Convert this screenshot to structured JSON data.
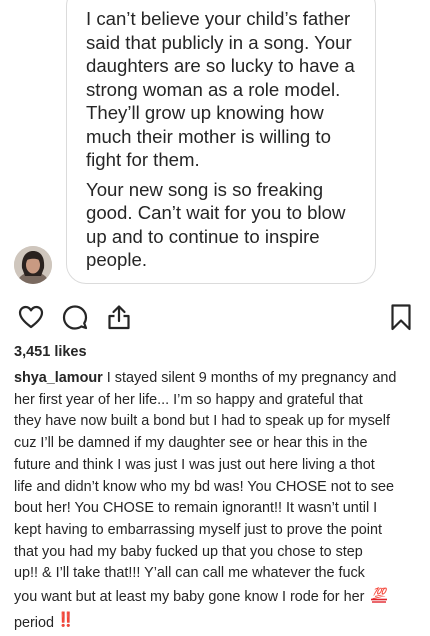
{
  "message": {
    "paragraph_1": "I can’t believe your child’s father\nsaid that publicly in a song. Your\ndaughters are so lucky to have a\nstrong woman as a role model.\nThey’ll grow up knowing how\nmuch their mother is willing to\nfight for them.",
    "paragraph_2": "Your new song is so freaking\ngood. Can’t wait for you to blow\nup and to continue to inspire\npeople."
  },
  "actions": {
    "icons": [
      "heart-icon",
      "comment-icon",
      "share-icon",
      "bookmark-icon"
    ]
  },
  "post": {
    "likes": "3,451 likes",
    "username": "shya_lamour",
    "caption_lines": [
      "I stayed silent 9 months of my pregnancy and",
      "her first year of her life... I’m so happy and grateful that",
      "they have now built a bond but I had to speak up for myself",
      "cuz I’ll be damned if my daughter see or hear this in the",
      "future and think I was just I was just out here living a thot",
      "life and didn’t know who my bd was! You CHOSE not to see",
      "bout her! You CHOSE to remain ignorant!! It wasn’t until I",
      "kept having to embarrassing myself just to prove the point",
      "that you had my baby fucked up that you chose to step",
      "up!! & I’ll take that!!! Y’all can call me whatever the fuck",
      "you want but at least my baby gone know I rode for her",
      "period"
    ],
    "emoji_hundred": "💯",
    "emoji_double_exclamation": "‼️"
  },
  "colors": {
    "text": "#262626",
    "bubble_border": "#dbdbdb",
    "emoji_red": "#e0242b"
  }
}
